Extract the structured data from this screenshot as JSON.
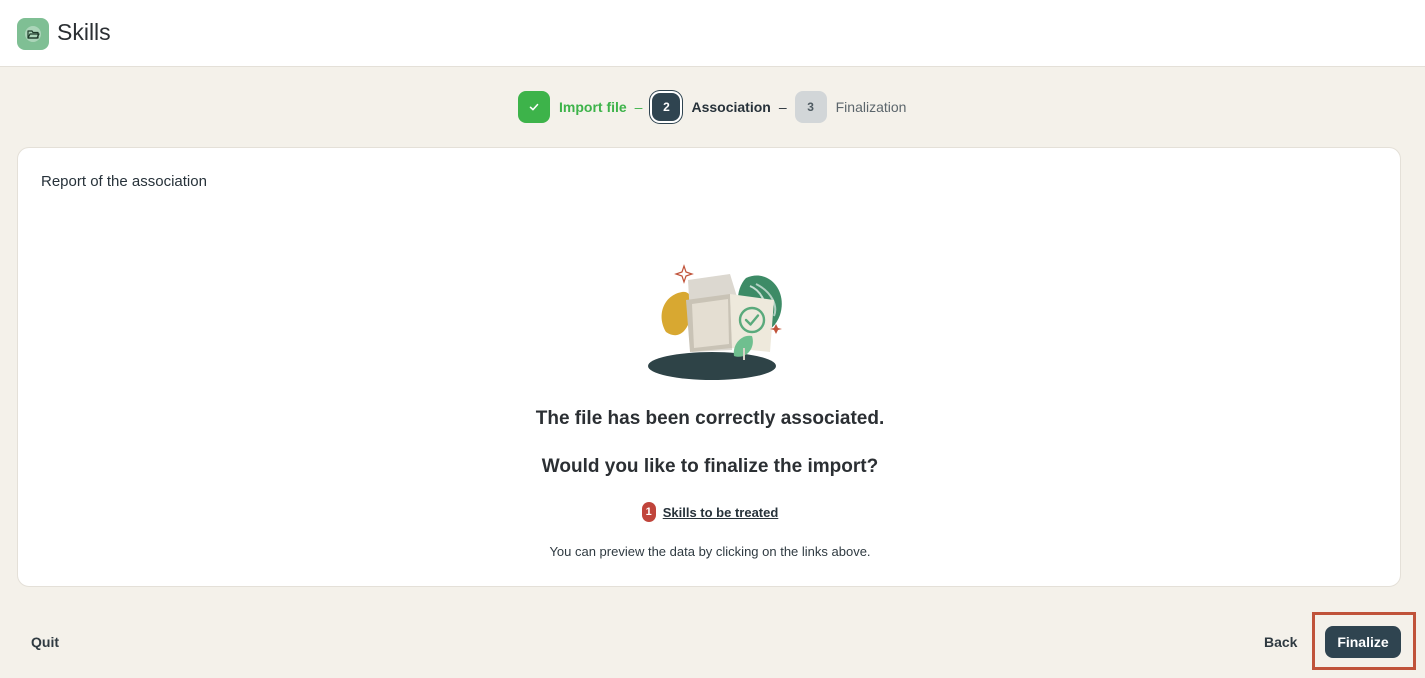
{
  "app": {
    "title": "Skills",
    "icon": "folder-open-icon",
    "accent": "#7fbf94"
  },
  "stepper": {
    "steps": [
      {
        "number": "1",
        "label": "Import file",
        "state": "done"
      },
      {
        "number": "2",
        "label": "Association",
        "state": "active"
      },
      {
        "number": "3",
        "label": "Finalization",
        "state": "todo"
      }
    ],
    "separator": "–"
  },
  "card": {
    "title": "Report of the association",
    "headline": "The file has been correctly associated.",
    "question": "Would you like to finalize the import?",
    "link": {
      "count": "1",
      "label": "Skills to be treated"
    },
    "hint": "You can preview the data by clicking on the links above."
  },
  "footer": {
    "quit_label": "Quit",
    "back_label": "Back",
    "finalize_label": "Finalize"
  },
  "colors": {
    "done": "#3db34a",
    "primary": "#2f4450",
    "badge": "#c0443b",
    "highlight": "#c0533a",
    "background": "#f4f1ea"
  }
}
